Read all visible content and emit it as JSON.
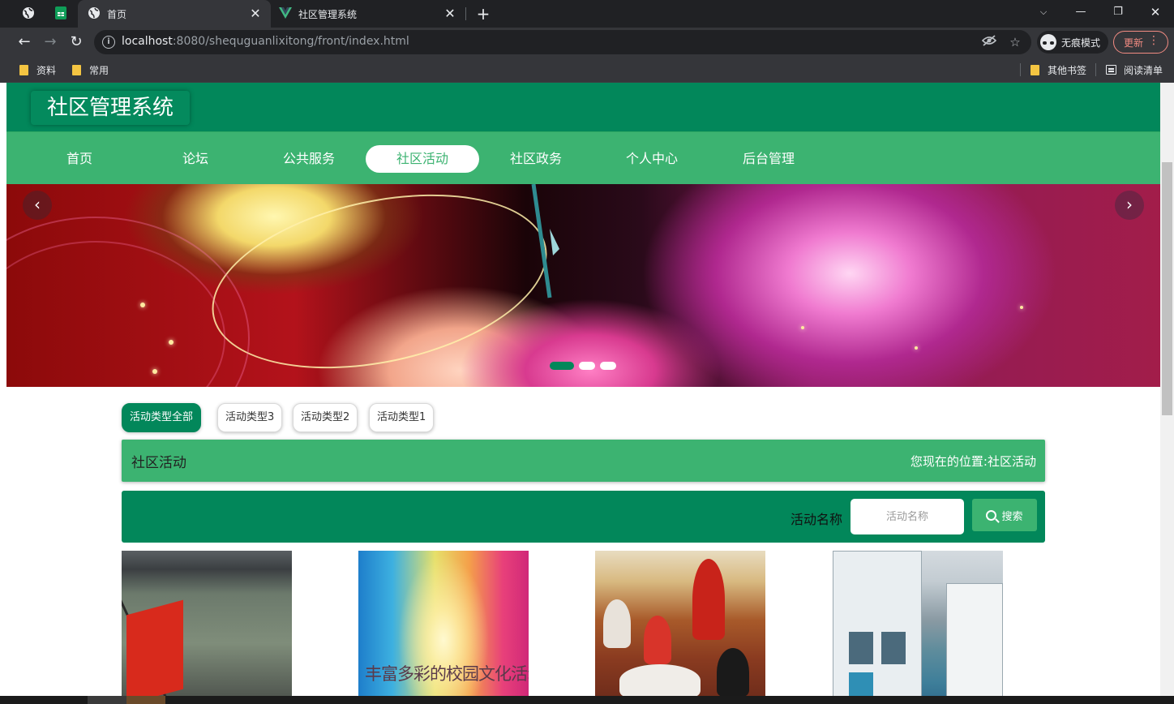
{
  "browser": {
    "tabs": [
      {
        "title": "",
        "icon": "globe-icon",
        "pinned": true
      },
      {
        "title": "",
        "icon": "sheets-icon",
        "pinned": true
      },
      {
        "title": "首页",
        "icon": "globe-icon",
        "active": true
      },
      {
        "title": "社区管理系统",
        "icon": "vue-icon"
      }
    ],
    "url_host": "localhost",
    "url_rest": ":8080/shequguanlixitong/front/index.html",
    "incognito_label": "无痕模式",
    "update_label": "更新",
    "bookmarks": [
      "资料",
      "常用"
    ],
    "bookmarks_right": [
      "其他书签",
      "阅读清单"
    ]
  },
  "site": {
    "title": "社区管理系统",
    "nav": [
      "首页",
      "论坛",
      "公共服务",
      "社区活动",
      "社区政务",
      "个人中心",
      "后台管理"
    ],
    "active_nav_index": 3
  },
  "banner": {
    "prev_icon": "chevron-left-icon",
    "next_icon": "chevron-right-icon",
    "slide_count": 3,
    "active_slide": 0
  },
  "filters": {
    "items": [
      "活动类型全部",
      "活动类型3",
      "活动类型2",
      "活动类型1"
    ],
    "active_index": 0
  },
  "section": {
    "title": "社区活动",
    "location_label": "您现在的位置",
    "location_sep": ":",
    "location_value": "社区活动"
  },
  "search": {
    "label": "活动名称",
    "placeholder": "活动名称",
    "button_label": "搜索"
  },
  "cards": [
    {
      "name": "activity-card-1",
      "caption": ""
    },
    {
      "name": "activity-card-2",
      "caption": "丰富多彩的校园文化活动"
    },
    {
      "name": "activity-card-3",
      "caption": ""
    },
    {
      "name": "activity-card-4",
      "caption": ""
    }
  ],
  "colors": {
    "primary": "#02875a",
    "secondary": "#3cb371",
    "white": "#ffffff"
  }
}
